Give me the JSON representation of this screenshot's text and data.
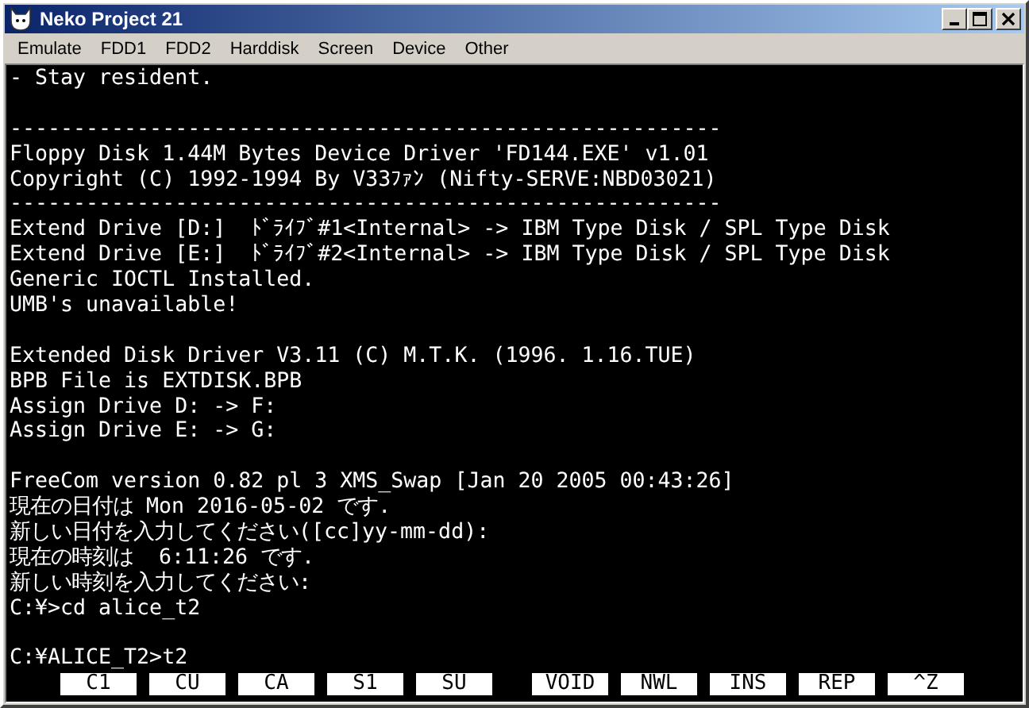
{
  "window": {
    "title": "Neko Project 21"
  },
  "menu": [
    "Emulate",
    "FDD1",
    "FDD2",
    "Harddisk",
    "Screen",
    "Device",
    "Other"
  ],
  "console_blocks": [
    [
      "- Stay resident."
    ],
    [
      "--------------------------------------------------------",
      "Floppy Disk 1.44M Bytes Device Driver 'FD144.EXE' v1.01",
      "Copyright (C) 1992-1994 By V33ﾌｧﾝ (Nifty-SERVE:NBD03021)",
      "--------------------------------------------------------",
      "Extend Drive [D:]  ﾄﾞﾗｲﾌﾞ#1<Internal> -> IBM Type Disk / SPL Type Disk",
      "Extend Drive [E:]  ﾄﾞﾗｲﾌﾞ#2<Internal> -> IBM Type Disk / SPL Type Disk",
      "Generic IOCTL Installed.",
      "UMB's unavailable!"
    ],
    [
      "Extended Disk Driver V3.11 (C) M.T.K. (1996. 1.16.TUE)",
      "BPB File is EXTDISK.BPB",
      "Assign Drive D: -> F:",
      "Assign Drive E: -> G:"
    ],
    [
      "FreeCom version 0.82 pl 3 XMS_Swap [Jan 20 2005 00:43:26]",
      "現在の日付は Mon 2016-05-02 です.",
      "新しい日付を入力してください([cc]yy-mm-dd):",
      "現在の時刻は  6:11:26 です.",
      "新しい時刻を入力してください:",
      "C:¥>cd alice_t2"
    ],
    [
      "C:¥ALICE_T2>t2"
    ]
  ],
  "function_key_groups": [
    [
      "C1",
      "CU",
      "CA",
      "S1",
      "SU"
    ],
    [
      "VOID",
      "NWL",
      "INS",
      "REP",
      "^Z"
    ]
  ]
}
